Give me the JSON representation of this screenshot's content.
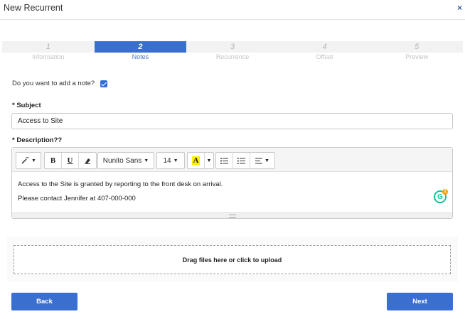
{
  "window": {
    "title": "New Recurrent",
    "close_glyph": "×"
  },
  "steps": [
    {
      "number": "1",
      "label": "Information",
      "active": false
    },
    {
      "number": "2",
      "label": "Notes",
      "active": true
    },
    {
      "number": "3",
      "label": "Recurrence",
      "active": false
    },
    {
      "number": "4",
      "label": "Offset",
      "active": false
    },
    {
      "number": "5",
      "label": "Preview",
      "active": false
    }
  ],
  "add_note": {
    "question": "Do you want to add a note?",
    "checked": true
  },
  "subject": {
    "label": "* Subject",
    "value": "Access to Site"
  },
  "description": {
    "label": "* Description??",
    "toolbar": {
      "font_family": "Nunito Sans",
      "font_size": "14",
      "bold": "B",
      "underline": "U",
      "highlight": "A"
    },
    "lines": [
      "Access to the Site is granted by reporting to the front desk on arrival.",
      "Please contact Jennifer at 407-000-000"
    ],
    "grammarly_count": "1"
  },
  "upload": {
    "text": "Drag files here or click to upload"
  },
  "buttons": {
    "back": "Back",
    "next": "Next"
  },
  "colors": {
    "accent": "#3b6fcf",
    "header_close": "#3a5f95",
    "grammarly": "#15c39a"
  }
}
